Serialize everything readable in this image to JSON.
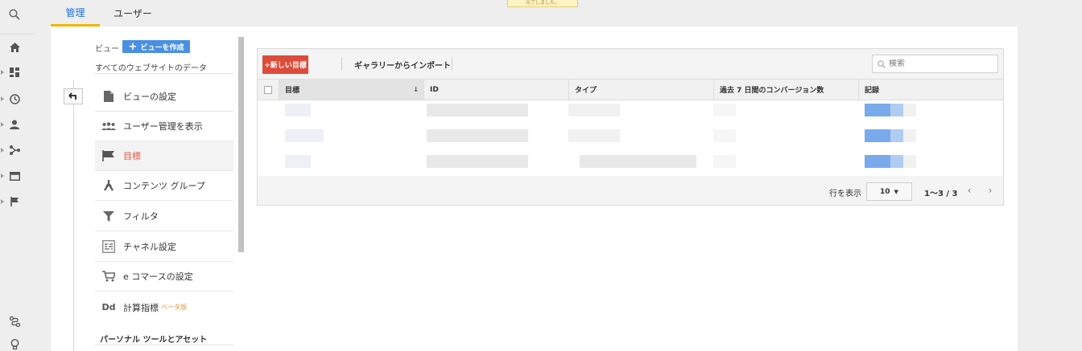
{
  "tabs": [
    {
      "label": "管理",
      "active": true
    },
    {
      "label": "ユーザー",
      "active": false
    }
  ],
  "toast_text": "元了しました。",
  "view": {
    "label": "ビュー",
    "create_button": "ビューを作成",
    "name": "すべてのウェブサイトのデータ"
  },
  "menu": [
    {
      "label": "ビューの設定",
      "icon": "document-icon"
    },
    {
      "label": "ユーザー管理を表示",
      "icon": "users-icon"
    },
    {
      "label": "目標",
      "icon": "flag-icon",
      "active": true
    },
    {
      "label": "コンテンツ グループ",
      "icon": "content-group-icon"
    },
    {
      "label": "フィルタ",
      "icon": "filter-icon"
    },
    {
      "label": "チャネル設定",
      "icon": "channel-icon"
    },
    {
      "label": "e コマースの設定",
      "icon": "cart-icon"
    },
    {
      "label": "計算指標",
      "icon": "dd-icon",
      "badge": "ベータ版"
    }
  ],
  "section_head": "パーソナル ツールとアセット",
  "goals": {
    "new_button": "+新しい目標",
    "import_button": "ギャラリーからインポート",
    "search_placeholder": "検索",
    "columns": [
      "目標",
      "ID",
      "タイプ",
      "過去 7 日間のコンバージョン数",
      "記録"
    ],
    "rows_label": "行を表示",
    "rows_per_page": "10",
    "page_info": "1～3 / 3"
  },
  "colors": {
    "accent": "#1a73e8",
    "tab_underline": "#f4b400",
    "new_goal": "#dd4b39",
    "create_view": "#4a90e2",
    "active_menu": "#e1553f"
  }
}
